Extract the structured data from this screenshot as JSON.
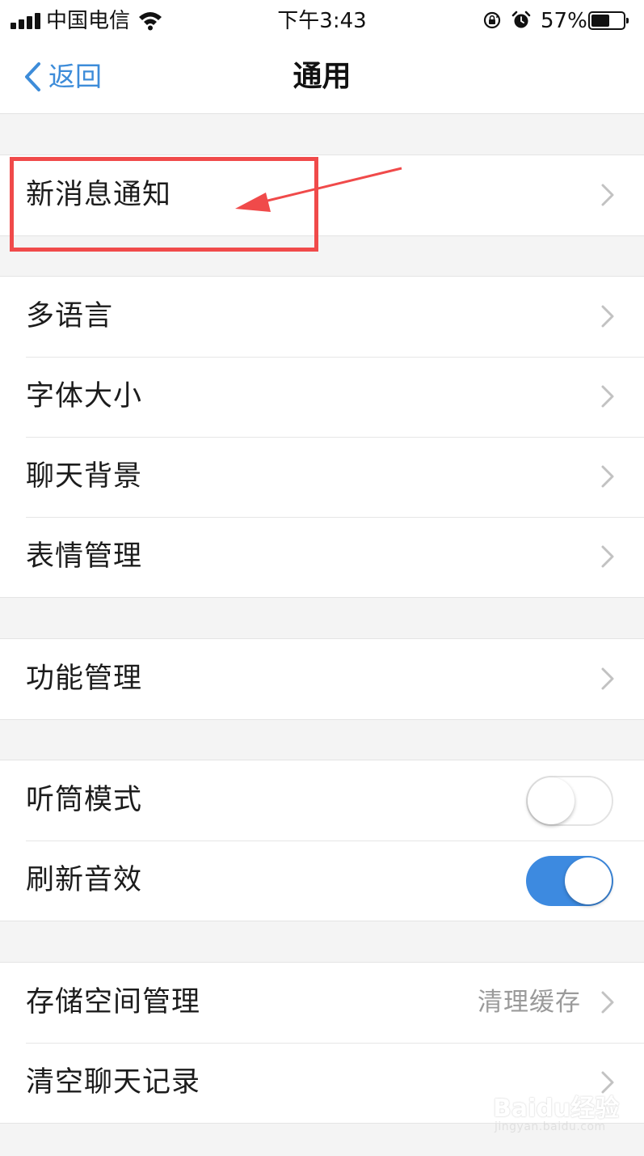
{
  "status_bar": {
    "carrier": "中国电信",
    "time": "下午3:43",
    "battery_percent": "57%",
    "battery_level": 0.57,
    "icons": [
      "signal-icon",
      "wifi-icon",
      "orientation-lock-icon",
      "alarm-icon",
      "battery-icon"
    ]
  },
  "nav": {
    "back_label": "返回",
    "title": "通用"
  },
  "groups": [
    {
      "items": [
        {
          "label": "新消息通知",
          "type": "disclosure"
        }
      ]
    },
    {
      "items": [
        {
          "label": "多语言",
          "type": "disclosure"
        },
        {
          "label": "字体大小",
          "type": "disclosure"
        },
        {
          "label": "聊天背景",
          "type": "disclosure"
        },
        {
          "label": "表情管理",
          "type": "disclosure"
        }
      ]
    },
    {
      "items": [
        {
          "label": "功能管理",
          "type": "disclosure"
        }
      ]
    },
    {
      "items": [
        {
          "label": "听筒模式",
          "type": "toggle",
          "on": false
        },
        {
          "label": "刷新音效",
          "type": "toggle",
          "on": true
        }
      ]
    },
    {
      "items": [
        {
          "label": "存储空间管理",
          "detail": "清理缓存",
          "type": "disclosure"
        },
        {
          "label": "清空聊天记录",
          "type": "disclosure"
        }
      ]
    }
  ],
  "annotation": {
    "highlight_color": "#f04a4a",
    "target": "新消息通知"
  },
  "watermark": {
    "brand": "Baidu经验",
    "url": "jingyan.baidu.com"
  },
  "colors": {
    "accent": "#3d8cd9",
    "toggle_on": "#3d8ae0",
    "background": "#f4f4f4"
  }
}
